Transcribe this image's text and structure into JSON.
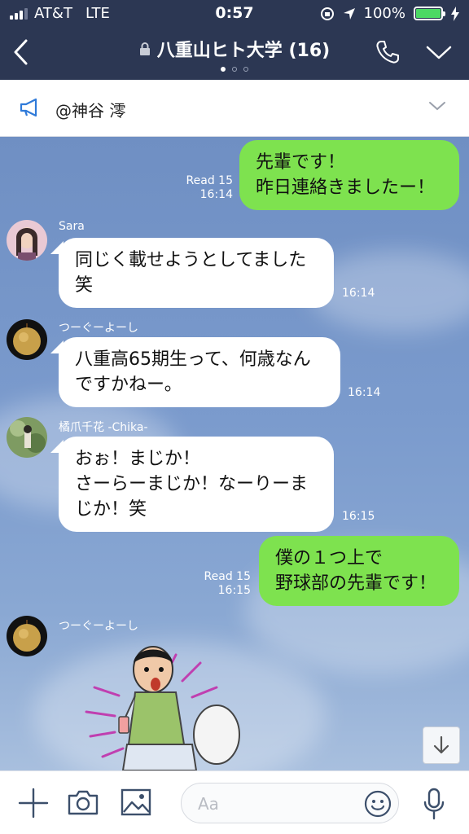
{
  "status_bar": {
    "carrier": "AT&T",
    "network": "LTE",
    "time": "0:57",
    "battery": "100%"
  },
  "header": {
    "title": "八重山ヒト大学 (16)"
  },
  "announcement": {
    "text": "@神谷 澪"
  },
  "messages": [
    {
      "text_lines": [
        "先輩です！",
        "昨日連絡きましたー！"
      ],
      "read": "Read 15",
      "time": "16:14"
    },
    {
      "sender": "Sara",
      "text_lines": [
        "同じく載せようとしてました",
        "笑"
      ],
      "time": "16:14"
    },
    {
      "sender": "つーぐーよーし",
      "text_lines": [
        "八重高65期生って、何歳なん",
        "ですかねー。"
      ],
      "time": "16:14"
    },
    {
      "sender": "橘爪千花 -Chika-",
      "text_lines": [
        "おぉ！まじか！",
        "さーらーまじか！なーりーま",
        "じか！笑"
      ],
      "time": "16:15"
    },
    {
      "text_lines": [
        "僕の１つ上で",
        "野球部の先輩です！"
      ],
      "read": "Read 15",
      "time": "16:15"
    },
    {
      "sender": "つーぐーよーし",
      "sticker": "surprised-boy-sticker"
    }
  ],
  "input": {
    "placeholder": "Aa"
  },
  "colors": {
    "header_bg": "#2c3753",
    "my_bubble": "#7ee24f",
    "other_bubble": "#ffffff",
    "chat_bg": "#7f9ecd",
    "battery": "#4cd964"
  }
}
